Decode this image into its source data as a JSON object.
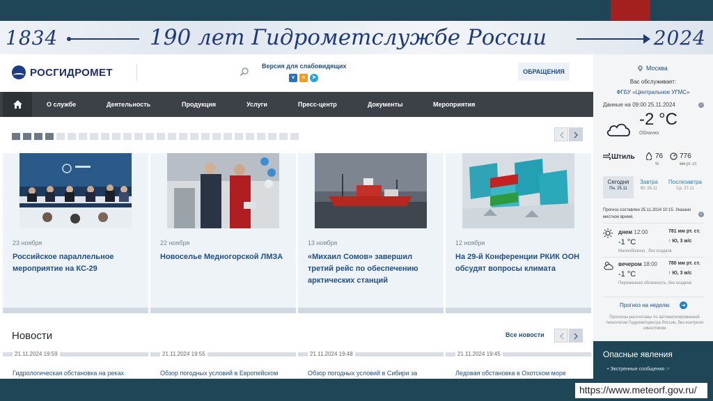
{
  "banner": {
    "year_start": "1834",
    "title": "190 лет Гидрометслужбе России",
    "year_end": "2024"
  },
  "header": {
    "logo": "РОСГИДРОМЕТ",
    "visually_impaired": "Версия для слабовидящих",
    "social": [
      "vk-icon",
      "ok-icon",
      "telegram-icon"
    ],
    "appeal_button": "ОБРАЩЕНИЯ"
  },
  "nav": {
    "items": [
      "О службе",
      "Деятельность",
      "Продукция",
      "Услуги",
      "Пресс-центр",
      "Документы",
      "Мероприятия"
    ]
  },
  "slider": {
    "total_dots": 26,
    "active_dots": 4
  },
  "cards": [
    {
      "date": "23 ноября",
      "title": "Российское параллельное мероприятие на КС-29"
    },
    {
      "date": "22 ноября",
      "title": "Новоселье Медногорской ЛМЗА"
    },
    {
      "date": "13 ноября",
      "title": "«Михаил Сомов» завершил третий рейс по обеспечению арктических станций"
    },
    {
      "date": "12 ноября",
      "title": "На 29-й Конференции РКИК ООН обсудят вопросы климата"
    }
  ],
  "news": {
    "heading": "Новости",
    "all_link": "Все новости",
    "items": [
      {
        "date": "21.11.2024 19:59",
        "title": "Гидрологическая обстановка на реках"
      },
      {
        "date": "21.11.2024 19:55",
        "title": "Обзор погодных условий в Европейском"
      },
      {
        "date": "21.11.2024 19:48",
        "title": "Обзор погодных условий в Сибири за"
      },
      {
        "date": "21.11.2024 19:45",
        "title": "Ледовая обстановка в Охотском море"
      }
    ]
  },
  "weather": {
    "city": "Москва",
    "served_by_label": "Вас обслуживает:",
    "served_by_org": "ФГБУ «Центральное УГМС»",
    "data_time": "Данные на 09:00 25.11.2024",
    "temperature": "-2 °C",
    "condition": "Облачно",
    "wind": "Штиль",
    "humidity": "76",
    "humidity_unit": "%",
    "pressure": "776",
    "pressure_unit": "мм рт. ст.",
    "days": [
      {
        "name": "Сегодня",
        "date": "Пн. 25.11"
      },
      {
        "name": "Завтра",
        "date": "Вт. 26.11"
      },
      {
        "name": "Послезавтра",
        "date": "Ср. 27.11"
      }
    ],
    "forecast_note": "Прогноз составлен 25.11.2024 10:15. Указано местное время.",
    "periods": [
      {
        "name": "днем",
        "time": "12:00",
        "temp": "-1 °C",
        "desc": "Малооблачно , без осадков",
        "pressure": "781 мм рт. ст.",
        "wind": "↑ Ю, 3 м/с"
      },
      {
        "name": "вечером",
        "time": "18:00",
        "temp": "-1 °C",
        "desc": "Переменная облачность, без осадков",
        "pressure": "780 мм рт. ст.",
        "wind": "↑ Ю, 3 м/с"
      }
    ],
    "week_link": "Прогноз на неделю",
    "source_note": "Прогнозы рассчитаны по автоматизированной технологии Гидрометцентра России, без контроля синоптиком"
  },
  "danger": {
    "heading": "Опасные явления",
    "item": "Экстренные сообщения"
  },
  "url": "https://www.meteorf.gov.ru/"
}
